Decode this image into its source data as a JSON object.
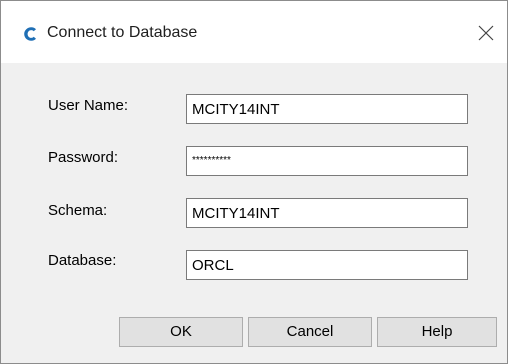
{
  "window": {
    "title": "Connect to Database",
    "icon": "c-app-icon",
    "close_icon": "close-icon",
    "accent_color": "#1f6fb5"
  },
  "form": {
    "fields": [
      {
        "label": "User Name:",
        "value": "MCITY14INT"
      },
      {
        "label": "Password:",
        "value": "**********"
      },
      {
        "label": "Schema:",
        "value": "MCITY14INT"
      },
      {
        "label": "Database:",
        "value": "ORCL"
      }
    ]
  },
  "buttons": {
    "ok": "OK",
    "cancel": "Cancel",
    "help": "Help"
  }
}
